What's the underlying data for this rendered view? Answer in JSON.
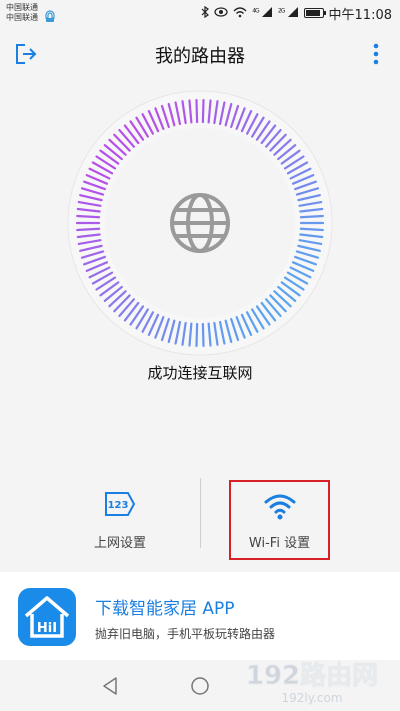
{
  "status_bar": {
    "carrier_1": "中国联通",
    "carrier_2": "中国联通",
    "network_1": "4G",
    "network_2": "2G",
    "time": "中午11:08",
    "battery_level": 0.85
  },
  "header": {
    "title": "我的路由器",
    "exit_icon": "exit-icon",
    "more_icon": "more-vertical-icon"
  },
  "router": {
    "status": "成功连接互联网",
    "center_icon": "globe-icon",
    "ring_colors": {
      "purple": "#b84fe8",
      "blue": "#5aa3ee"
    }
  },
  "actions": [
    {
      "label": "上网设置",
      "icon": "internet-setup-icon",
      "badge": "123"
    },
    {
      "label": "Wi-Fi 设置",
      "icon": "wifi-icon"
    }
  ],
  "promo": {
    "title": "下载智能家居 APP",
    "subtitle": "抛弃旧电脑，手机平板玩转路由器",
    "app_icon_text": "HiI"
  },
  "watermark": {
    "main": "192路由网",
    "sub": "192ly.com"
  },
  "colors": {
    "accent": "#1a7fe0",
    "highlight_box": "#d71f24"
  }
}
